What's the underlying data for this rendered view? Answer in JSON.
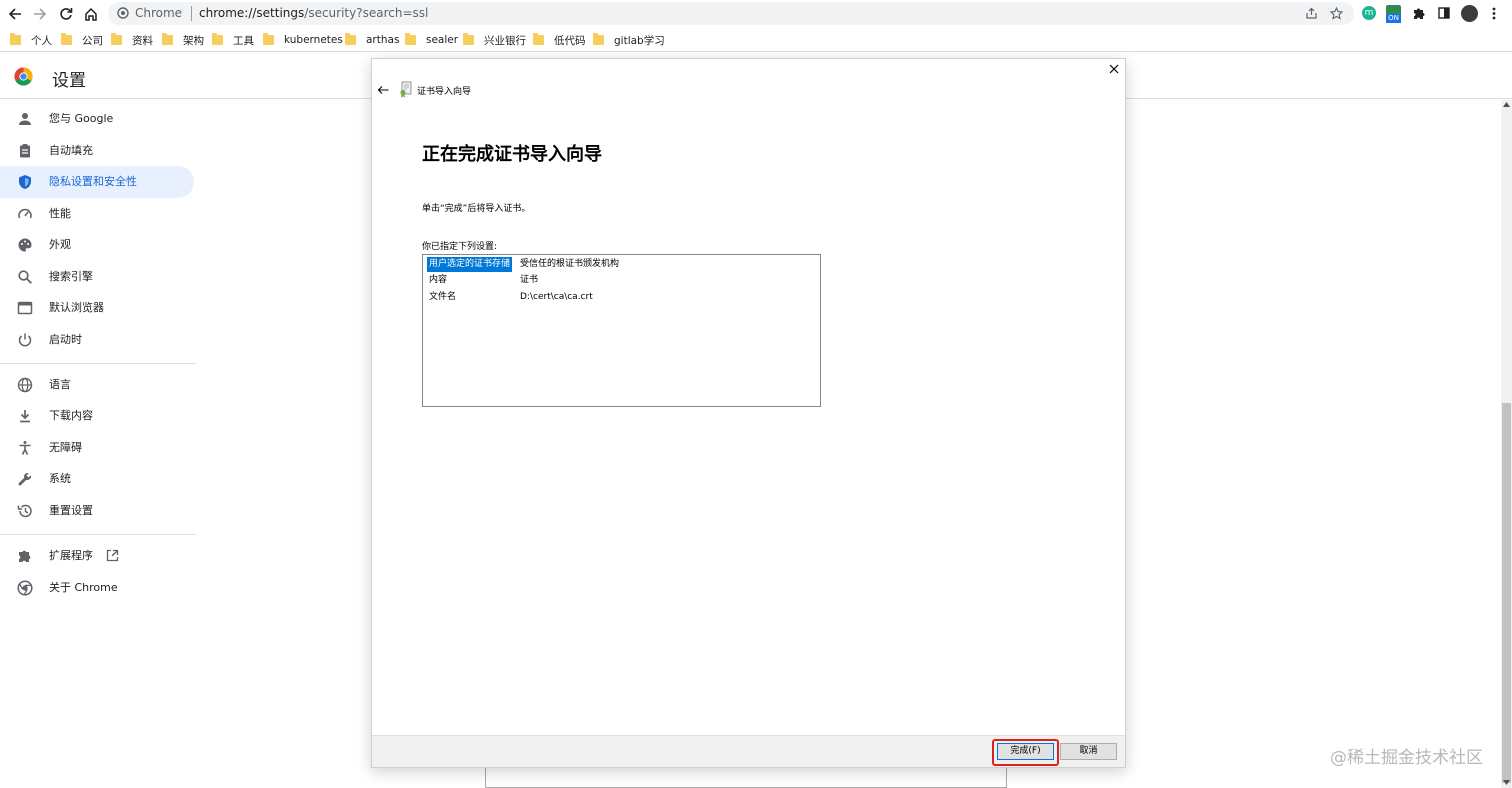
{
  "browser": {
    "chip_label": "Chrome",
    "url_host": "chrome://settings",
    "url_path": "/security?search=ssl"
  },
  "bookmarks": [
    "个人",
    "公司",
    "资料",
    "架构",
    "工具",
    "kubernetes",
    "arthas",
    "sealer",
    "兴业银行",
    "低代码",
    "gitlab学习"
  ],
  "settings": {
    "title": "设置",
    "nav": [
      {
        "label": "您与 Google",
        "icon": "person-icon"
      },
      {
        "label": "自动填充",
        "icon": "clipboard-icon"
      },
      {
        "label": "隐私设置和安全性",
        "icon": "shield-icon",
        "active": true
      },
      {
        "label": "性能",
        "icon": "speedometer-icon"
      },
      {
        "label": "外观",
        "icon": "palette-icon"
      },
      {
        "label": "搜索引擎",
        "icon": "search-icon"
      },
      {
        "label": "默认浏览器",
        "icon": "browser-icon"
      },
      {
        "label": "启动时",
        "icon": "power-icon"
      },
      {
        "label": "语言",
        "icon": "globe-icon"
      },
      {
        "label": "下载内容",
        "icon": "download-icon"
      },
      {
        "label": "无障碍",
        "icon": "accessibility-icon"
      },
      {
        "label": "系统",
        "icon": "wrench-icon"
      },
      {
        "label": "重置设置",
        "icon": "restore-icon"
      },
      {
        "label": "扩展程序",
        "icon": "puzzle-icon"
      },
      {
        "label": "关于 Chrome",
        "icon": "chrome-icon"
      }
    ]
  },
  "dialog": {
    "window_title": "证书导入向导",
    "heading": "正在完成证书导入向导",
    "instruction": "单击“完成”后将导入证书。",
    "settings_label": "你已指定下列设置:",
    "rows": [
      {
        "key": "用户选定的证书存储",
        "value": "受信任的根证书颁发机构",
        "selected": true
      },
      {
        "key": "内容",
        "value": "证书"
      },
      {
        "key": "文件名",
        "value": "D:\\cert\\ca\\ca.crt"
      }
    ],
    "finish_label": "完成(F)",
    "cancel_label": "取消"
  },
  "watermark": "@稀土掘金技术社区",
  "colors": {
    "accent": "#1a73e8",
    "active_bg": "#e8f0fe",
    "selection": "#0078d7",
    "highlight": "#e02020"
  }
}
